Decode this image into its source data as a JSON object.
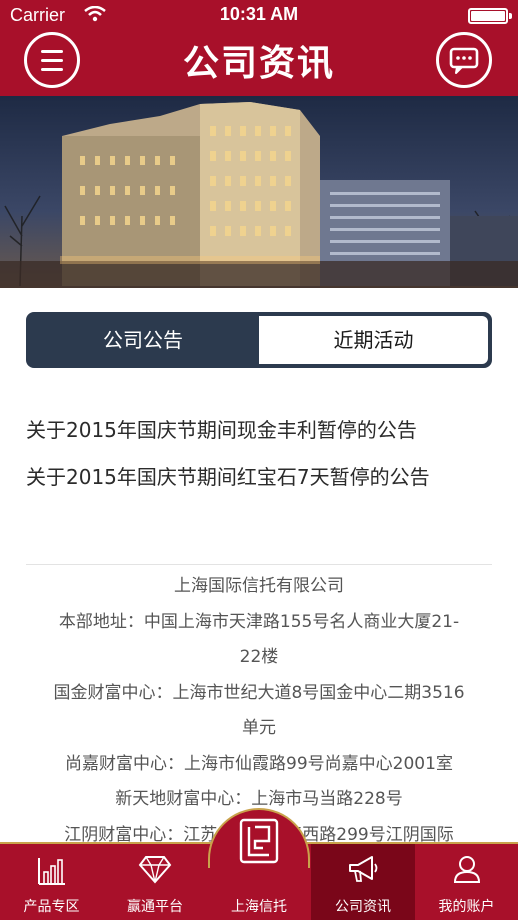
{
  "status_bar": {
    "carrier": "Carrier",
    "time": "10:31 AM"
  },
  "nav": {
    "title": "公司资讯",
    "menu_icon": "hamburger-menu-icon",
    "chat_icon": "chat-bubble-icon"
  },
  "banner": {
    "description_icon": "building-photo"
  },
  "tabs": [
    {
      "label": "公司公告",
      "selected": false
    },
    {
      "label": "近期活动",
      "selected": true
    }
  ],
  "news": [
    {
      "title": "关于2015年国庆节期间现金丰利暂停的公告"
    },
    {
      "title": "关于2015年国庆节期间红宝石7天暂停的公告"
    }
  ],
  "footer_info": {
    "lines": [
      "上海国际信托有限公司",
      "本部地址：中国上海市天津路155号名人商业大厦21-",
      "22楼",
      "国金财富中心：上海市世纪大道8号国金中心二期3516",
      "单元",
      "尚嘉财富中心：上海市仙霞路99号尚嘉中心2001室",
      "新天地财富中心：上海市马当路228号",
      "江阴财富中心：江苏省江阴市江西路299号江阴国际"
    ]
  },
  "tabbar": {
    "items": [
      {
        "label": "产品专区",
        "icon": "bar-chart-icon"
      },
      {
        "label": "赢通平台",
        "icon": "diamond-icon"
      },
      {
        "label": "上海信托",
        "icon": "logo-emblem-icon"
      },
      {
        "label": "公司资讯",
        "icon": "megaphone-icon",
        "active": true
      },
      {
        "label": "我的账户",
        "icon": "user-icon"
      }
    ]
  },
  "colors": {
    "brand_red": "#a8102a",
    "active_tab_red": "#7a0619",
    "tabs_dark": "#2c3a4e",
    "gold_accent": "#c9a24b"
  }
}
